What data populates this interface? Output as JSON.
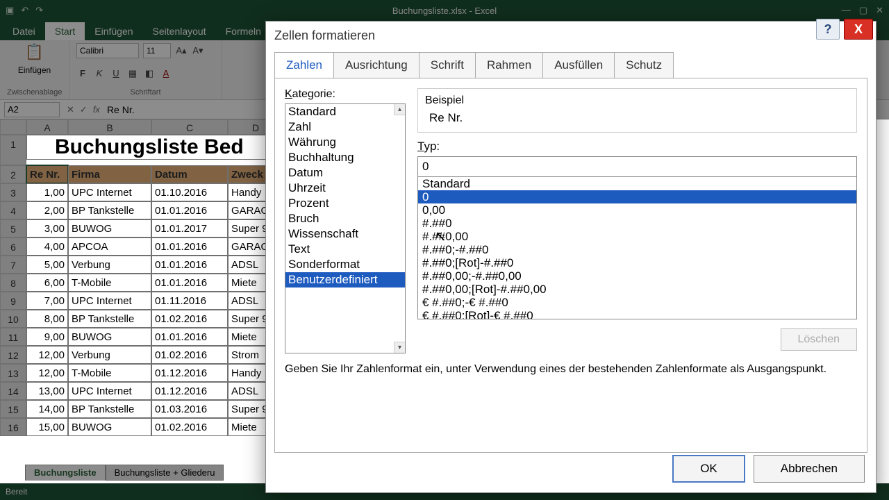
{
  "app": {
    "title": "Buchungsliste.xlsx - Excel"
  },
  "ribbon": {
    "file": "Datei",
    "tabs": [
      "Start",
      "Einfügen",
      "Seitenlayout",
      "Formeln"
    ],
    "active_tab": "Start",
    "clipboard_label": "Zwischenablage",
    "paste": "Einfügen",
    "font_label": "Schriftart",
    "font_name": "Calibri",
    "font_size": "11"
  },
  "formula_bar": {
    "name_box": "A2",
    "value": "Re Nr."
  },
  "columns": [
    "A",
    "B",
    "C",
    "D"
  ],
  "title_cell": "Buchungsliste Bed",
  "headers": [
    "Re Nr.",
    "Firma",
    "Datum",
    "Zweck"
  ],
  "rows": [
    {
      "n": "1,00",
      "f": "UPC Internet",
      "d": "01.10.2016",
      "z": "Handy"
    },
    {
      "n": "2,00",
      "f": "BP Tankstelle",
      "d": "01.01.2016",
      "z": "GARAG"
    },
    {
      "n": "3,00",
      "f": "BUWOG",
      "d": "01.01.2017",
      "z": "Super 9"
    },
    {
      "n": "4,00",
      "f": "APCOA",
      "d": "01.01.2016",
      "z": "GARAG"
    },
    {
      "n": "5,00",
      "f": "Verbung",
      "d": "01.01.2016",
      "z": "ADSL"
    },
    {
      "n": "6,00",
      "f": "T-Mobile",
      "d": "01.01.2016",
      "z": "Miete"
    },
    {
      "n": "7,00",
      "f": "UPC Internet",
      "d": "01.11.2016",
      "z": "ADSL"
    },
    {
      "n": "8,00",
      "f": "BP Tankstelle",
      "d": "01.02.2016",
      "z": "Super 9"
    },
    {
      "n": "9,00",
      "f": "BUWOG",
      "d": "01.01.2016",
      "z": "Miete"
    },
    {
      "n": "12,00",
      "f": "Verbung",
      "d": "01.02.2016",
      "z": "Strom"
    },
    {
      "n": "12,00",
      "f": "T-Mobile",
      "d": "01.12.2016",
      "z": "Handy"
    },
    {
      "n": "13,00",
      "f": "UPC Internet",
      "d": "01.12.2016",
      "z": "ADSL"
    },
    {
      "n": "14,00",
      "f": "BP Tankstelle",
      "d": "01.03.2016",
      "z": "Super 9"
    },
    {
      "n": "15,00",
      "f": "BUWOG",
      "d": "01.02.2016",
      "z": "Miete"
    }
  ],
  "sheet_tabs": [
    "Buchungsliste",
    "Buchungsliste + Gliederu"
  ],
  "status": "Bereit",
  "dialog": {
    "title": "Zellen formatieren",
    "tabs": [
      "Zahlen",
      "Ausrichtung",
      "Schrift",
      "Rahmen",
      "Ausfüllen",
      "Schutz"
    ],
    "active_tab": "Zahlen",
    "category_label": "Kategorie:",
    "categories": [
      "Standard",
      "Zahl",
      "Währung",
      "Buchhaltung",
      "Datum",
      "Uhrzeit",
      "Prozent",
      "Bruch",
      "Wissenschaft",
      "Text",
      "Sonderformat",
      "Benutzerdefiniert"
    ],
    "selected_category": "Benutzerdefiniert",
    "example_label": "Beispiel",
    "example_value": "Re Nr.",
    "type_label": "Typ:",
    "type_value": "0",
    "type_list": [
      "Standard",
      "0",
      "0,00",
      "#.##0",
      "#.##0,00",
      "#.##0;-#.##0",
      "#.##0;[Rot]-#.##0",
      "#.##0,00;-#.##0,00",
      "#.##0,00;[Rot]-#.##0,00",
      "€ #.##0;-€ #.##0",
      "€ #.##0;[Rot]-€ #.##0"
    ],
    "selected_type": "0",
    "delete_btn": "Löschen",
    "hint": "Geben Sie Ihr Zahlenformat ein, unter Verwendung eines der bestehenden Zahlenformate als Ausgangspunkt.",
    "ok": "OK",
    "cancel": "Abbrechen"
  }
}
